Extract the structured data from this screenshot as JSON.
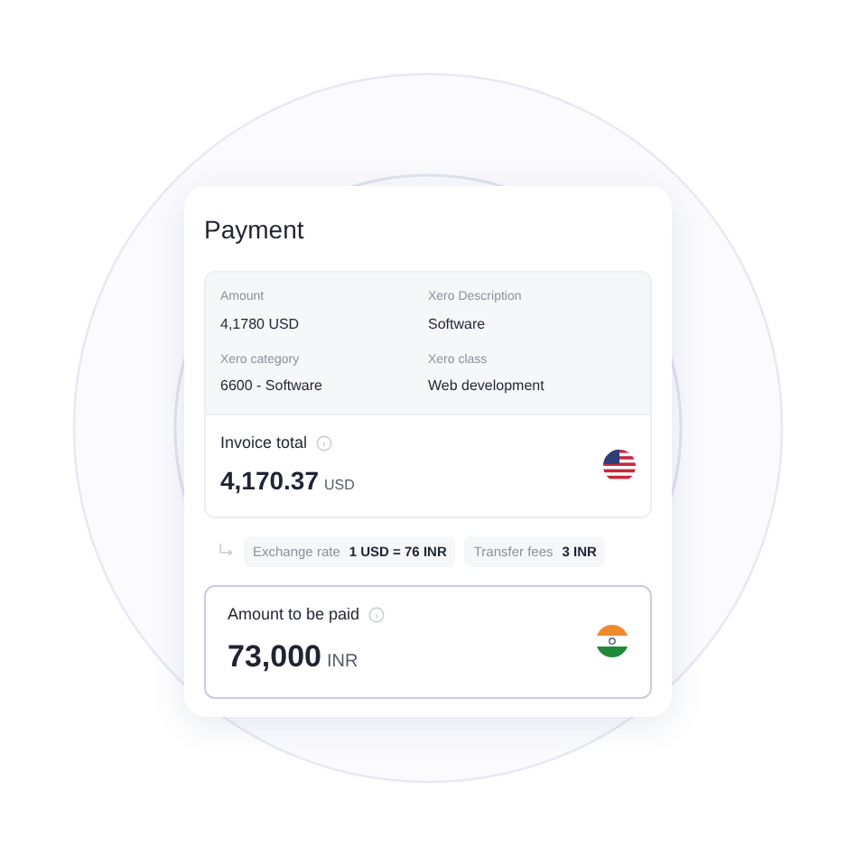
{
  "title": "Payment",
  "details": [
    {
      "label": "Amount",
      "value": "4,1780 USD"
    },
    {
      "label": "Xero Description",
      "value": "Software"
    },
    {
      "label": "Xero category",
      "value": "6600 - Software"
    },
    {
      "label": "Xero class",
      "value": "Web development"
    }
  ],
  "invoice_total": {
    "label": "Invoice total",
    "amount": "4,170.37",
    "currency": "USD",
    "kind": "us"
  },
  "fees": [
    {
      "label": "Exchange rate",
      "value": "1 USD = 76 INR"
    },
    {
      "label": "Transfer fees",
      "value": "3 INR"
    }
  ],
  "amount_to_pay": {
    "label": "Amount to be paid",
    "amount": "73,000",
    "currency": "INR",
    "kind": "in"
  }
}
